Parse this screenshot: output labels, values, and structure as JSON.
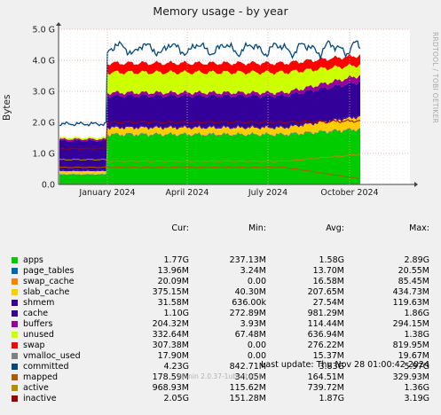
{
  "header": {
    "title": "Memory usage - by year",
    "side_label": "RRDTOOL / TOBI OETIKER",
    "ylabel": "Bytes"
  },
  "colors": {
    "background": "#f0f0f0",
    "plot_background": "#ffffff",
    "grid": "#e8a0a0",
    "axis": "#404040"
  },
  "chart_data": {
    "type": "area",
    "title": "Memory usage - by year",
    "ylabel": "Bytes",
    "ylim": [
      0,
      5.0
    ],
    "y_unit": "G",
    "y_ticks": [
      "0.0",
      "1.0 G",
      "2.0 G",
      "3.0 G",
      "4.0 G",
      "5.0 G"
    ],
    "x_ticks": [
      "January 2024",
      "April 2024",
      "July 2024",
      "October 2024"
    ],
    "stacked": true,
    "series": [
      {
        "name": "apps",
        "color": "#00cc00",
        "before": 0.32,
        "after": 1.6,
        "recent": 1.77
      },
      {
        "name": "page_tables",
        "color": "#0066b3",
        "before": 0.01,
        "after": 0.013,
        "recent": 0.014
      },
      {
        "name": "swap_cache",
        "color": "#ff8000",
        "before": 0.0,
        "after": 0.015,
        "recent": 0.02
      },
      {
        "name": "slab_cache",
        "color": "#ffcc00",
        "before": 0.1,
        "after": 0.2,
        "recent": 0.375
      },
      {
        "name": "shmem",
        "color": "#330099",
        "before": 0.03,
        "after": 0.03,
        "recent": 0.032
      },
      {
        "name": "cache",
        "color": "#330099",
        "before": 0.95,
        "after": 1.0,
        "recent": 1.1
      },
      {
        "name": "buffers",
        "color": "#990099",
        "before": 0.05,
        "after": 0.1,
        "recent": 0.204
      },
      {
        "name": "unused",
        "color": "#ccff00",
        "before": 0.05,
        "after": 0.65,
        "recent": 0.333
      },
      {
        "name": "swap",
        "color": "#ff0000",
        "before": 0.0,
        "after": 0.3,
        "recent": 0.307
      }
    ],
    "lines": [
      {
        "name": "committed",
        "color": "#00487d",
        "before": 1.95,
        "after": 4.2,
        "recent": 4.23
      },
      {
        "name": "mapped",
        "color": "#b35a00",
        "before": 0.55,
        "after": 0.55,
        "recent": 0.18
      },
      {
        "name": "active",
        "color": "#b38f00",
        "before": 0.8,
        "after": 0.75,
        "recent": 0.97
      },
      {
        "name": "inactive",
        "color": "#990000",
        "before": 1.15,
        "after": 2.0,
        "recent": 2.05
      },
      {
        "name": "vmalloc_used",
        "color": "#808080",
        "before": 0.02,
        "after": 0.018,
        "recent": 0.018
      }
    ]
  },
  "legend": {
    "headers": {
      "cur": "Cur:",
      "min": "Min:",
      "avg": "Avg:",
      "max": "Max:"
    },
    "rows": [
      {
        "name": "apps",
        "color": "#00cc00",
        "cur": "1.77G",
        "min": "237.13M",
        "avg": "1.58G",
        "max": "2.89G"
      },
      {
        "name": "page_tables",
        "color": "#0066b3",
        "cur": "13.96M",
        "min": "3.24M",
        "avg": "13.70M",
        "max": "20.55M"
      },
      {
        "name": "swap_cache",
        "color": "#ff8000",
        "cur": "20.09M",
        "min": "0.00",
        "avg": "16.58M",
        "max": "85.45M"
      },
      {
        "name": "slab_cache",
        "color": "#ffcc00",
        "cur": "375.15M",
        "min": "40.30M",
        "avg": "207.65M",
        "max": "434.73M"
      },
      {
        "name": "shmem",
        "color": "#330099",
        "cur": "31.58M",
        "min": "636.00k",
        "avg": "27.54M",
        "max": "119.63M"
      },
      {
        "name": "cache",
        "color": "#330099",
        "cur": "1.10G",
        "min": "272.89M",
        "avg": "981.29M",
        "max": "1.86G"
      },
      {
        "name": "buffers",
        "color": "#990099",
        "cur": "204.32M",
        "min": "3.93M",
        "avg": "114.44M",
        "max": "294.15M"
      },
      {
        "name": "unused",
        "color": "#ccff00",
        "cur": "332.64M",
        "min": "67.48M",
        "avg": "636.94M",
        "max": "1.38G"
      },
      {
        "name": "swap",
        "color": "#ff0000",
        "cur": "307.38M",
        "min": "0.00",
        "avg": "276.22M",
        "max": "819.95M"
      },
      {
        "name": "vmalloc_used",
        "color": "#808080",
        "cur": "17.90M",
        "min": "0.00",
        "avg": "15.37M",
        "max": "19.67M"
      },
      {
        "name": "committed",
        "color": "#00487d",
        "cur": "4.23G",
        "min": "842.71M",
        "avg": "3.83G",
        "max": "5.97G"
      },
      {
        "name": "mapped",
        "color": "#b35a00",
        "cur": "178.59M",
        "min": "34.05M",
        "avg": "164.51M",
        "max": "329.93M"
      },
      {
        "name": "active",
        "color": "#b38f00",
        "cur": "968.93M",
        "min": "115.62M",
        "avg": "739.72M",
        "max": "1.36G"
      },
      {
        "name": "inactive",
        "color": "#990000",
        "cur": "2.05G",
        "min": "151.28M",
        "avg": "1.87G",
        "max": "3.19G"
      }
    ]
  },
  "footer": {
    "last_update": "Last update: Thu Nov 28 01:00:42 2024",
    "version": "Munin 2.0.37-1ubuntu0.1"
  }
}
